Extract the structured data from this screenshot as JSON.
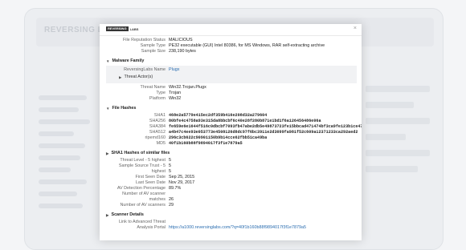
{
  "background": {
    "logo": "REVERSING LABS"
  },
  "panel": {
    "logo_badge": "REVERSING",
    "logo_text": "LABS",
    "close_glyph": "×"
  },
  "file_info": [
    {
      "k": "File Reputation Status",
      "v": "MALICIOUS"
    },
    {
      "k": "Sample Type",
      "v": "PE32 executable (GUI) Intel 80386, for MS Windows, RAR self-extracting archive"
    },
    {
      "k": "Sample Size",
      "v": "238,190 bytes"
    }
  ],
  "malware_family": {
    "title": "Malware Family",
    "rl_name_label": "ReversingLabs Name",
    "rl_name_value": "Plugx",
    "threat_actors_label": "Threat Actor(s)"
  },
  "threat": [
    {
      "k": "Threat Name",
      "v": "Win32.Trojan.Plugx"
    },
    {
      "k": "Type",
      "v": "Trojan"
    },
    {
      "k": "Platform",
      "v": "Win32"
    }
  ],
  "file_hashes": {
    "title": "File Hashes",
    "rows": [
      {
        "k": "SHA1",
        "v": "468e2a5779e415ec2df359b416e208d32a279604"
      },
      {
        "k": "SHA256",
        "v": "80bfe4c4758a93e315da8bbcbf6c40e28f280b871e1bd1f6a126456486e06a"
      },
      {
        "k": "SHA384",
        "v": "fe659e6e1644f516c0dbcbf7093fb47abe2db5e49873723fe15bbcad471474bf3ca9fe123b1ce47"
      },
      {
        "k": "SHA512",
        "v": "a4b47c4ee93e053773e4508126d8dc97f6bc3911e2d3099fa981f52c609a12371233ca292aed2"
      },
      {
        "k": "ripemd160",
        "v": "296c3cb622c90901150b9b14cce62fbb51ca49ba"
      },
      {
        "k": "MD5",
        "v": "40f1b160b88f9894017f3f1e7879a5"
      }
    ]
  },
  "sha1_similar": {
    "title": "SHA1 Hashes of similar files",
    "rows": [
      {
        "k": "Threat Level - 5 highest",
        "v": "5"
      },
      {
        "k": "Sample Source Trust - 5",
        "v": "5"
      },
      {
        "k": "highest",
        "v": "5"
      },
      {
        "k": "First Seen Date",
        "v": "Sep 25, 2015"
      },
      {
        "k": "Last Seen Date",
        "v": "Nov 29, 2017"
      },
      {
        "k": "AV Detection Percentage",
        "v": "89.7%"
      },
      {
        "k": "Number of AV scanner",
        "v": ""
      },
      {
        "k": "matches",
        "v": "26"
      },
      {
        "k": "Number of AV scanners",
        "v": "29"
      }
    ]
  },
  "scanner": {
    "title": "Scanner Details",
    "rows": [
      {
        "k": "Link to Advanced Threat",
        "v": ""
      },
      {
        "k": "Analysis Portal",
        "v": "https://a1000.reversinglabs.com/?q=40f1b160b88f9894017f3f1e7879a5"
      }
    ]
  },
  "colors": {
    "link": "#2a6db0",
    "panel": "#ffffff",
    "shade": "#f1f2f4"
  },
  "icons": {
    "collapse": "triangle-down-icon",
    "expand": "triangle-right-icon"
  }
}
